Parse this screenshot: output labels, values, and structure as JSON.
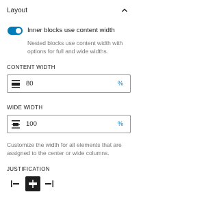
{
  "header": {
    "title": "Layout"
  },
  "toggle": {
    "label": "Inner blocks use content width",
    "checked": true,
    "help": "Nested blocks use content width with options for full and wide widths."
  },
  "content_width": {
    "label": "CONTENT WIDTH",
    "value": "80",
    "unit": "%"
  },
  "wide_width": {
    "label": "WIDE WIDTH",
    "value": "100",
    "unit": "%"
  },
  "description": "Customize the width for all elements that are assigned to the center or wide columns.",
  "justification": {
    "label": "JUSTIFICATION",
    "options": [
      "justify-left-icon",
      "justify-center-icon",
      "justify-right-icon"
    ],
    "selected": "justify-center-icon"
  },
  "colors": {
    "accent": "#007cba",
    "text": "#1e1e1e",
    "muted": "#757575",
    "selected_bg": "#1e1e1e"
  }
}
